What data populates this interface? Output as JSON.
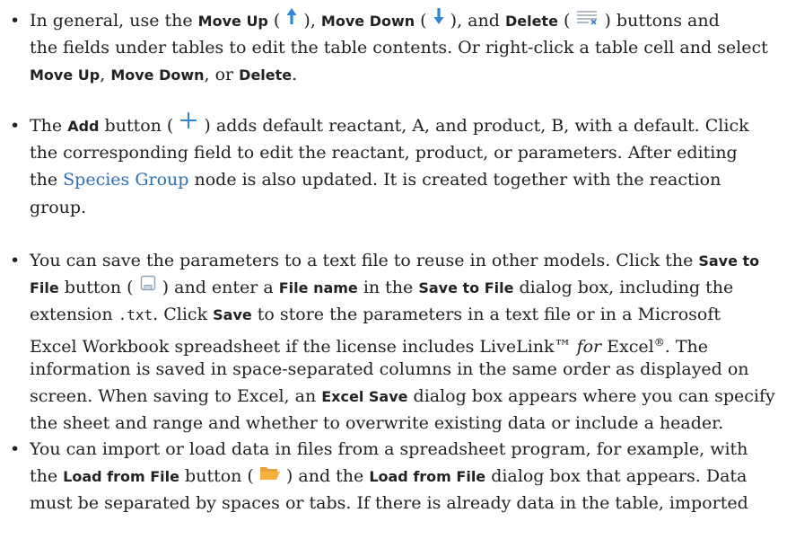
{
  "bullet_char": "•",
  "items": [
    {
      "lines": [
        [
          {
            "t": "In general, use the "
          },
          {
            "t": "Move Up",
            "s": "b"
          },
          {
            "t": " ( "
          },
          {
            "icon": "move-up-icon"
          },
          {
            "t": " ), "
          },
          {
            "t": "Move Down",
            "s": "b"
          },
          {
            "t": " ( "
          },
          {
            "icon": "move-down-icon"
          },
          {
            "t": " ), and "
          },
          {
            "t": "Delete",
            "s": "b"
          },
          {
            "t": " ( "
          },
          {
            "icon": "delete-icon"
          },
          {
            "t": " ) buttons and"
          }
        ],
        [
          {
            "t": "the fields under tables to edit the table contents. Or right-click a table cell and select"
          }
        ],
        [
          {
            "t": "Move Up",
            "s": "b"
          },
          {
            "t": ", "
          },
          {
            "t": "Move Down",
            "s": "b"
          },
          {
            "t": ", or "
          },
          {
            "t": "Delete",
            "s": "b"
          },
          {
            "t": "."
          }
        ]
      ]
    },
    {
      "lines": [
        [
          {
            "t": "The "
          },
          {
            "t": "Add",
            "s": "b"
          },
          {
            "t": " button ( "
          },
          {
            "icon": "add-icon"
          },
          {
            "t": " ) adds default reactant, A, and product, B, with a default. Click"
          }
        ],
        [
          {
            "t": "the corresponding field to edit the reactant, product, or parameters. After editing"
          }
        ],
        [
          {
            "t": "the "
          },
          {
            "t": "Species Group",
            "s": "link"
          },
          {
            "t": " node is also updated. It is created together with the reaction"
          }
        ],
        [
          {
            "t": "group."
          }
        ]
      ]
    },
    {
      "lines": [
        [
          {
            "t": "You can save the parameters to a text file to reuse in other models. Click the "
          },
          {
            "t": "Save to",
            "s": "b"
          }
        ],
        [
          {
            "t": "File",
            "s": "b"
          },
          {
            "t": " button ( "
          },
          {
            "icon": "save-icon"
          },
          {
            "t": " ) and enter a "
          },
          {
            "t": "File name",
            "s": "b"
          },
          {
            "t": " in the "
          },
          {
            "t": "Save to File",
            "s": "b"
          },
          {
            "t": " dialog box, including the"
          }
        ],
        [
          {
            "t": "extension "
          },
          {
            "t": ".txt",
            "s": "mono"
          },
          {
            "t": ". Click "
          },
          {
            "t": "Save",
            "s": "b"
          },
          {
            "t": " to store the parameters in a text file or in a Microsoft"
          }
        ],
        [
          {
            "t": "Excel Workbook spreadsheet if the license includes LiveLink™ "
          },
          {
            "t": "for",
            "s": "it"
          },
          {
            "t": " Excel"
          },
          {
            "t": "®",
            "s": "sup"
          },
          {
            "t": ". The"
          }
        ],
        [
          {
            "t": "information is saved in space-separated columns in the same order as displayed on"
          }
        ],
        [
          {
            "t": "screen. When saving to Excel, an "
          },
          {
            "t": "Excel Save",
            "s": "b"
          },
          {
            "t": " dialog box appears where you can specify"
          }
        ],
        [
          {
            "t": "the sheet and range and whether to overwrite existing data or include a header."
          }
        ]
      ]
    },
    {
      "lines": [
        [
          {
            "t": "You can import or load data in files from a spreadsheet program, for example, with"
          }
        ],
        [
          {
            "t": "the "
          },
          {
            "t": "Load from File",
            "s": "b"
          },
          {
            "t": " button ( "
          },
          {
            "icon": "load-folder-icon"
          },
          {
            "t": " ) and the "
          },
          {
            "t": "Load from File",
            "s": "b"
          },
          {
            "t": " dialog box that appears. Data"
          }
        ],
        [
          {
            "t": "must be separated by spaces or tabs. If there is already data in the table, imported"
          }
        ]
      ]
    }
  ]
}
